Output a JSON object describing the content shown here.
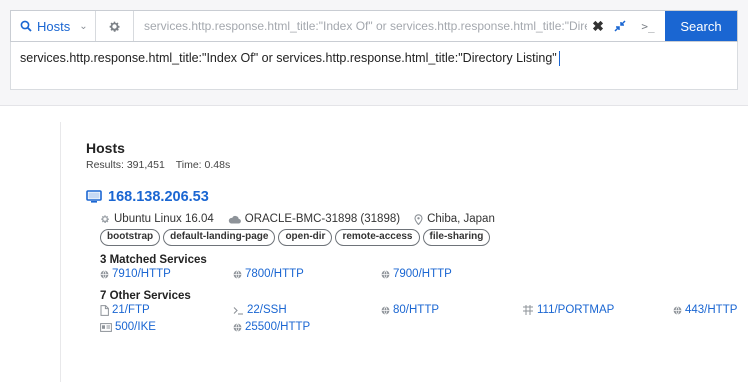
{
  "search": {
    "scope_label": "Hosts",
    "query_preview": "services.http.response.html_title:\"Index Of\" or services.http.response.html_title:\"Dire",
    "query_full": "services.http.response.html_title:\"Index Of\" or services.http.response.html_title:\"Directory Listing\"",
    "terminal_label": ">_",
    "clear_label": "✖",
    "search_button": "Search"
  },
  "results": {
    "heading": "Hosts",
    "results_count": "Results: 391,451",
    "time": "Time: 0.48s",
    "host": {
      "ip": "168.138.206.53",
      "os": "Ubuntu Linux 16.04",
      "asn": "ORACLE-BMC-31898 (31898)",
      "location": "Chiba, Japan",
      "tags": [
        "bootstrap",
        "default-landing-page",
        "open-dir",
        "remote-access",
        "file-sharing"
      ],
      "matched_title": "3 Matched Services",
      "matched_services": [
        {
          "label": "7910/HTTP",
          "icon": "globe-icon"
        },
        {
          "label": "7800/HTTP",
          "icon": "globe-icon"
        },
        {
          "label": "7900/HTTP",
          "icon": "globe-icon"
        }
      ],
      "other_title": "7 Other Services",
      "other_services_row1": [
        {
          "label": "21/FTP",
          "icon": "file-icon"
        },
        {
          "label": "22/SSH",
          "icon": "terminal-icon"
        },
        {
          "label": "80/HTTP",
          "icon": "globe-icon"
        },
        {
          "label": "111/PORTMAP",
          "icon": "network-icon"
        },
        {
          "label": "443/HTTP",
          "icon": "globe-icon"
        }
      ],
      "other_services_row2": [
        {
          "label": "500/IKE",
          "icon": "id-card-icon"
        },
        {
          "label": "25500/HTTP",
          "icon": "globe-icon"
        }
      ]
    }
  },
  "colors": {
    "accent": "#1a66d2",
    "background": "#ffffff",
    "top_area": "#f6f6f8"
  }
}
